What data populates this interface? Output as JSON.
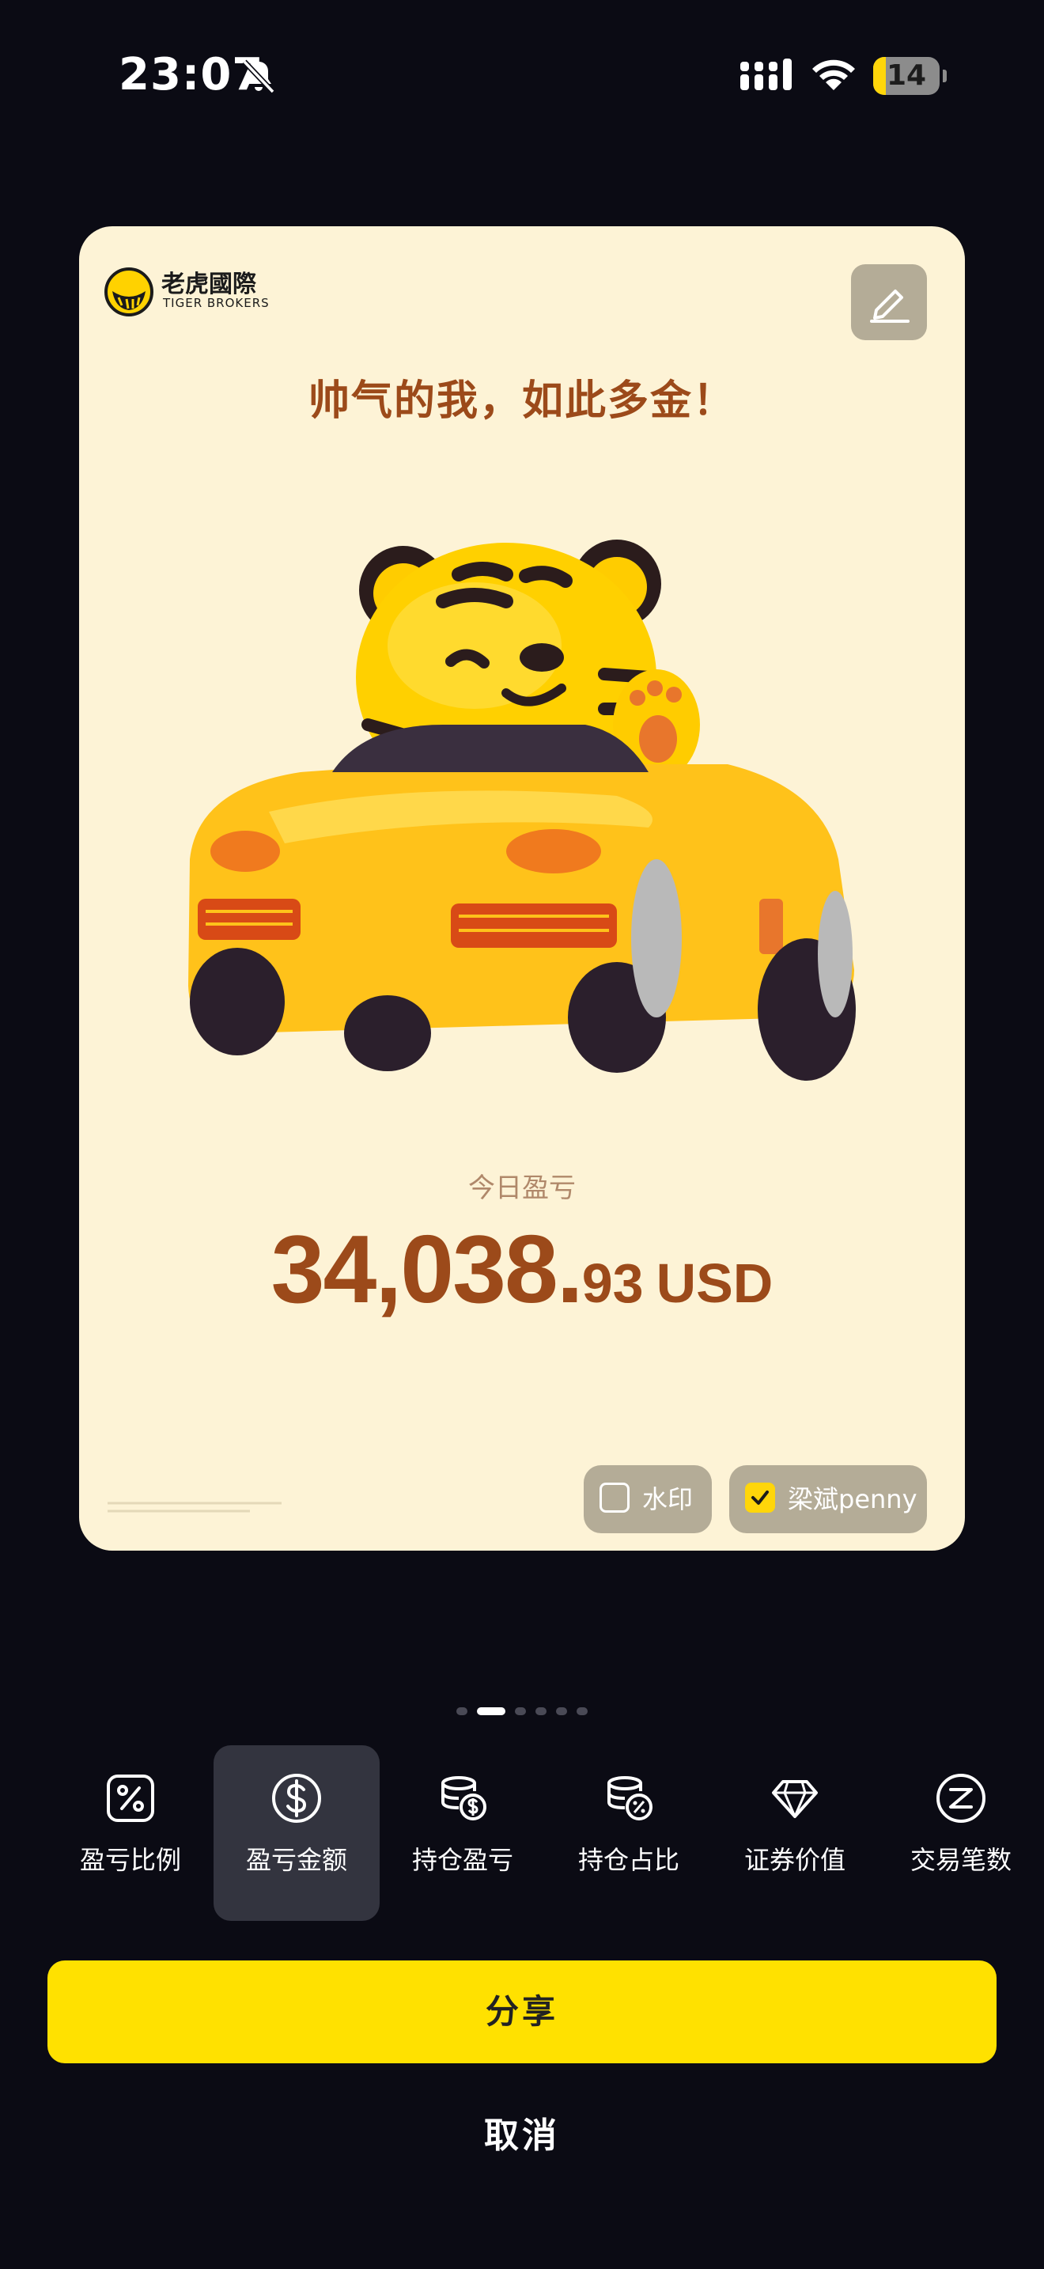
{
  "status_bar": {
    "time": "23:07",
    "battery": "14",
    "icons": [
      "bell-slash-icon",
      "signal-icon",
      "wifi-icon",
      "battery-icon"
    ]
  },
  "card": {
    "brand_name": "老虎國際",
    "brand_sub": "TIGER BROKERS",
    "headline": "帅气的我，如此多金！",
    "metric_label": "今日盈亏",
    "metric_integer": "34,038.",
    "metric_decimal": "93",
    "metric_unit": "USD",
    "watermark_label": "水印",
    "watermark_checked": false,
    "name_label": "梁斌penny",
    "name_checked": true,
    "colors": {
      "background": "#fdf3d6",
      "text_accent": "#9c4a1a",
      "chip": "#b4ac97"
    }
  },
  "pager": {
    "count": 6,
    "active_index": 1
  },
  "tabs": [
    {
      "label": "盈亏比例",
      "icon": "percent-icon"
    },
    {
      "label": "盈亏金额",
      "icon": "dollar-icon"
    },
    {
      "label": "持仓盈亏",
      "icon": "coin-stack-dollar-icon"
    },
    {
      "label": "持仓占比",
      "icon": "coin-stack-percent-icon"
    },
    {
      "label": "证券价值",
      "icon": "diamond-icon"
    },
    {
      "label": "交易笔数",
      "icon": "z-circle-icon"
    }
  ],
  "active_tab": 1,
  "actions": {
    "share": "分享",
    "cancel": "取消"
  },
  "colors": {
    "screen_bg": "#0b0b14",
    "primary": "#ffe100",
    "tab_active_bg": "#33343f"
  }
}
